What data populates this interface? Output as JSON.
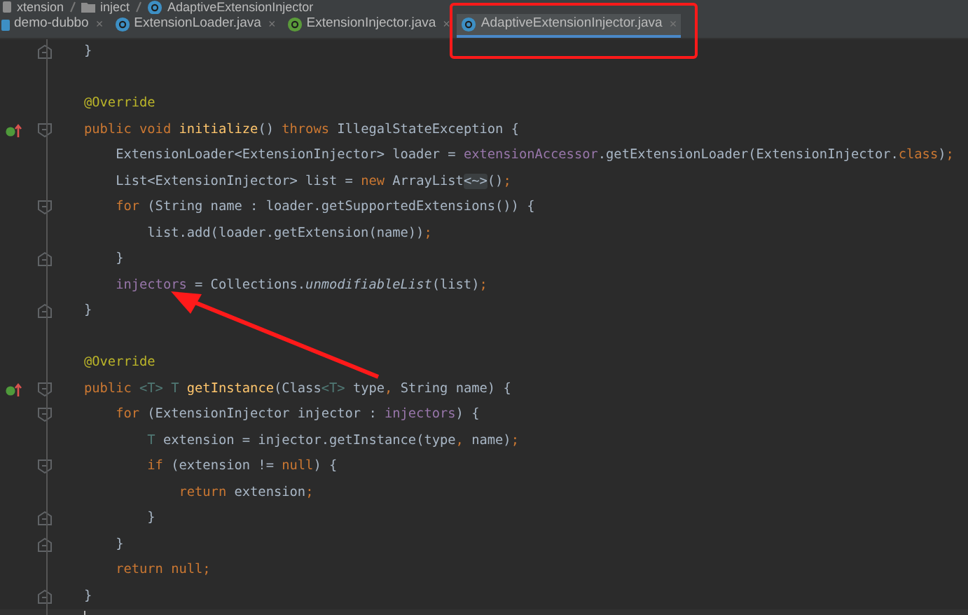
{
  "breadcrumb": [
    {
      "kind": "package",
      "label": "xtension"
    },
    {
      "kind": "folder",
      "label": "inject"
    },
    {
      "kind": "class",
      "label": "AdaptiveExtensionInjector"
    }
  ],
  "tabs": [
    {
      "kind": "module",
      "label": "demo-dubbo",
      "close": "×",
      "selected": false
    },
    {
      "kind": "class",
      "label": "ExtensionLoader.java",
      "close": "×",
      "selected": false
    },
    {
      "kind": "interface",
      "label": "ExtensionInjector.java",
      "close": "×",
      "selected": false
    },
    {
      "kind": "class",
      "label": "AdaptiveExtensionInjector.java",
      "close": "×",
      "selected": true
    }
  ],
  "code_lines": [
    {
      "current": false,
      "fold_close": true,
      "tokens": [
        {
          "kind": "plain",
          "text": "}"
        }
      ]
    },
    {
      "current": false
    },
    {
      "current": false,
      "tokens": [
        {
          "kind": "annotation",
          "text": "@Override"
        }
      ]
    },
    {
      "current": false,
      "override": true,
      "fold_open": true,
      "tokens": [
        {
          "kind": "keyword",
          "text": "public void "
        },
        {
          "kind": "method",
          "text": "initialize"
        },
        {
          "kind": "plain",
          "text": "() "
        },
        {
          "kind": "keyword",
          "text": "throws "
        },
        {
          "kind": "plain",
          "text": "IllegalStateException {"
        }
      ]
    },
    {
      "current": false,
      "tokens": [
        {
          "kind": "plain",
          "text": "    ExtensionLoader<ExtensionInjector> loader = "
        },
        {
          "kind": "field",
          "text": "extensionAccessor"
        },
        {
          "kind": "plain",
          "text": ".getExtensionLoader(ExtensionInjector."
        },
        {
          "kind": "keyword",
          "text": "class"
        },
        {
          "kind": "plain",
          "text": ")"
        },
        {
          "kind": "keyword",
          "text": ";"
        }
      ]
    },
    {
      "current": false,
      "tokens": [
        {
          "kind": "plain",
          "text": "    List<ExtensionInjector> list = "
        },
        {
          "kind": "keyword",
          "text": "new "
        },
        {
          "kind": "plain",
          "text": "ArrayList"
        },
        {
          "kind": "folded",
          "text": "<~>"
        },
        {
          "kind": "plain",
          "text": "()"
        },
        {
          "kind": "keyword",
          "text": ";"
        }
      ]
    },
    {
      "current": false,
      "fold_open": true,
      "tokens": [
        {
          "kind": "keyword",
          "text": "    for "
        },
        {
          "kind": "plain",
          "text": "(String name : loader.getSupportedExtensions()) {"
        }
      ]
    },
    {
      "current": false,
      "tokens": [
        {
          "kind": "plain",
          "text": "        list.add(loader.getExtension(name))"
        },
        {
          "kind": "keyword",
          "text": ";"
        }
      ]
    },
    {
      "current": false,
      "fold_close": true,
      "tokens": [
        {
          "kind": "plain",
          "text": "    }"
        }
      ]
    },
    {
      "current": false,
      "tokens": [
        {
          "kind": "field",
          "text": "    injectors"
        },
        {
          "kind": "plain",
          "text": " = Collections."
        },
        {
          "kind": "static",
          "text": "unmodifiableList"
        },
        {
          "kind": "plain",
          "text": "(list)"
        },
        {
          "kind": "keyword",
          "text": ";"
        }
      ]
    },
    {
      "current": false,
      "fold_close": true,
      "tokens": [
        {
          "kind": "plain",
          "text": "}"
        }
      ]
    },
    {
      "current": false
    },
    {
      "current": false,
      "tokens": [
        {
          "kind": "annotation",
          "text": "@Override"
        }
      ]
    },
    {
      "current": false,
      "override": true,
      "fold_open": true,
      "tokens": [
        {
          "kind": "keyword",
          "text": "public "
        },
        {
          "kind": "typeparam",
          "text": "<T> T "
        },
        {
          "kind": "method",
          "text": "getInstance"
        },
        {
          "kind": "plain",
          "text": "(Class"
        },
        {
          "kind": "typeparam",
          "text": "<T>"
        },
        {
          "kind": "plain",
          "text": " type"
        },
        {
          "kind": "keyword",
          "text": ", "
        },
        {
          "kind": "plain",
          "text": "String name) {"
        }
      ]
    },
    {
      "current": false,
      "fold_open": true,
      "tokens": [
        {
          "kind": "keyword",
          "text": "    for "
        },
        {
          "kind": "plain",
          "text": "(ExtensionInjector injector : "
        },
        {
          "kind": "field",
          "text": "injectors"
        },
        {
          "kind": "plain",
          "text": ") {"
        }
      ]
    },
    {
      "current": false,
      "tokens": [
        {
          "kind": "typeparam",
          "text": "        T"
        },
        {
          "kind": "plain",
          "text": " extension = injector.getInstance(type"
        },
        {
          "kind": "keyword",
          "text": ", "
        },
        {
          "kind": "plain",
          "text": "name)"
        },
        {
          "kind": "keyword",
          "text": ";"
        }
      ]
    },
    {
      "current": false,
      "fold_open": true,
      "tokens": [
        {
          "kind": "keyword",
          "text": "        if "
        },
        {
          "kind": "plain",
          "text": "(extension != "
        },
        {
          "kind": "keyword",
          "text": "null"
        },
        {
          "kind": "plain",
          "text": ") {"
        }
      ]
    },
    {
      "current": false,
      "tokens": [
        {
          "kind": "keyword",
          "text": "            return "
        },
        {
          "kind": "plain",
          "text": "extension"
        },
        {
          "kind": "keyword",
          "text": ";"
        }
      ]
    },
    {
      "current": false,
      "fold_close": true,
      "tokens": [
        {
          "kind": "plain",
          "text": "        }"
        }
      ]
    },
    {
      "current": false,
      "fold_close": true,
      "tokens": [
        {
          "kind": "plain",
          "text": "    }"
        }
      ]
    },
    {
      "current": false,
      "tokens": [
        {
          "kind": "keyword",
          "text": "    return null;"
        }
      ]
    },
    {
      "current": false,
      "fold_close": true,
      "tokens": [
        {
          "kind": "plain",
          "text": "}"
        }
      ]
    },
    {
      "current": true
    }
  ],
  "annotations": {
    "highlight_box": true,
    "arrow": true
  }
}
